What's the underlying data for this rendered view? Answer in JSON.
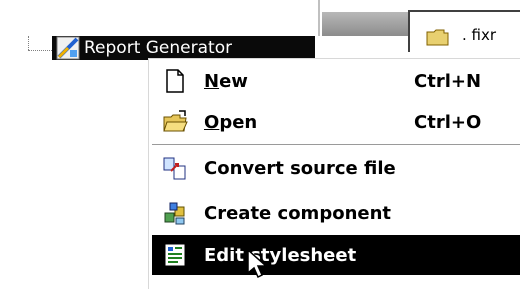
{
  "tree": {
    "node_label": "Report Generator"
  },
  "background": {
    "fragment_text": ". fixr"
  },
  "menu": {
    "items": [
      {
        "label_first": "N",
        "label_rest": "ew",
        "accel": "Ctrl+N"
      },
      {
        "label_first": "O",
        "label_rest": "pen",
        "accel": "Ctrl+O"
      },
      {
        "label": "Convert source file"
      },
      {
        "label": "Create component"
      },
      {
        "label": "Edit stylesheet"
      }
    ]
  },
  "colors": {
    "highlight": "#000000",
    "menu_bg": "#ffffff"
  }
}
